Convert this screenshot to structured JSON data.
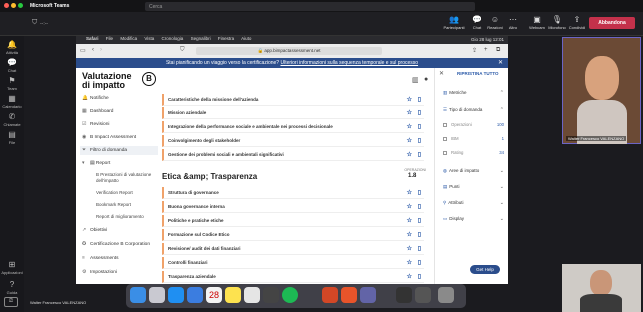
{
  "teams": {
    "title": "Microsoft Teams",
    "search_placeholder": "Cerca",
    "timer": "--:--",
    "toolbar": [
      {
        "label": "Partecipanti",
        "icon": "people-icon"
      },
      {
        "label": "Chat",
        "icon": "chat-icon"
      },
      {
        "label": "Reazioni",
        "icon": "reaction-icon"
      },
      {
        "label": "Altro",
        "icon": "more-icon"
      },
      {
        "label": "Webcam",
        "icon": "camera-icon"
      },
      {
        "label": "Microfono",
        "icon": "mic-icon"
      },
      {
        "label": "Condividi",
        "icon": "share-icon"
      }
    ],
    "leave_label": "Abbandona",
    "rail": [
      {
        "label": "Attività",
        "icon": "bell-icon"
      },
      {
        "label": "Chat",
        "icon": "chat-icon"
      },
      {
        "label": "Team",
        "icon": "team-icon"
      },
      {
        "label": "Calendario",
        "icon": "calendar-icon"
      },
      {
        "label": "Chiamate",
        "icon": "phone-icon"
      },
      {
        "label": "File",
        "icon": "file-icon"
      },
      {
        "label": "Applicazioni",
        "icon": "apps-icon"
      },
      {
        "label": "Guida",
        "icon": "help-icon"
      }
    ],
    "self_name": "Walter Francesco VALENZANO",
    "main_tile_name": "Walter Francesco VALENZANO"
  },
  "mac": {
    "menu": [
      "Safari",
      "File",
      "Modifica",
      "Vista",
      "Cronologia",
      "Segnalibri",
      "Finestra",
      "Aiuto"
    ],
    "clock": "Gio 28 lug 12:01",
    "url": "app.bimpactassessment.net"
  },
  "banner": {
    "text": "Stai pianificando un viaggio verso la certificazione?",
    "link": "Ulteriori informazioni sulla sequenza temporale e sul processo"
  },
  "brand": {
    "line1": "Valutazione",
    "line2": "di impatto",
    "logo": "B"
  },
  "nav": [
    {
      "label": "Notifiche",
      "icon": "bell-icon"
    },
    {
      "label": "Dashboard",
      "icon": "dashboard-icon"
    },
    {
      "label": "Revisioni",
      "icon": "review-icon"
    },
    {
      "label": "B Impact Assessment",
      "icon": "assessment-icon"
    },
    {
      "label": "Filtro di domanda",
      "icon": "filter-icon"
    },
    {
      "label": "Report",
      "icon": "report-icon"
    },
    {
      "label": "Obiettivi",
      "icon": "target-icon"
    },
    {
      "label": "Certificazione B Corporation",
      "icon": "certificate-icon"
    },
    {
      "label": "Assessments",
      "icon": "assessments-icon"
    },
    {
      "label": "Impostazioni",
      "icon": "settings-icon"
    }
  ],
  "report_sub": [
    "B Prestazioni di valutazione dell'impatto",
    "Verification Report",
    "Bookmark Report",
    "Report di miglioramento"
  ],
  "questions_top": [
    "Caratteristiche della missione dell'azienda",
    "Mission aziendale",
    "Integrazione della performance sociale e ambientale nei processi decisionale",
    "Coinvolgimento degli stakeholder",
    "Gestione dei problemi sociali e ambientali significativi"
  ],
  "section": {
    "title": "Etica &amp; Trasparenza",
    "ops_label": "OPERAZIONI",
    "value": "1.8"
  },
  "questions_bottom": [
    "Struttura di governance",
    "Buona governance interna",
    "Politiche e pratiche etiche",
    "Formazione sul Codice Etico",
    "Revisione/ audit dei dati finanziari",
    "Controlli finanziari",
    "Trasparenza aziendale"
  ],
  "filter": {
    "reset": "RIPRISTINA TUTTO",
    "metrics": "Metriche",
    "question_type": "Tipo di domanda",
    "options": [
      {
        "label": "Operazioni",
        "count": "100"
      },
      {
        "label": "IBM",
        "count": "1"
      },
      {
        "label": "Rating",
        "count": "34"
      }
    ],
    "areas": "Aree di impatto",
    "points": "Punti",
    "attributes": "Attributi",
    "display": "Display"
  },
  "help": "Get Help"
}
